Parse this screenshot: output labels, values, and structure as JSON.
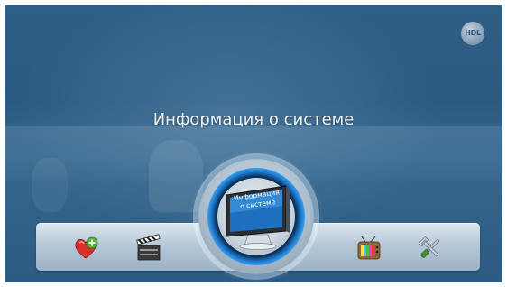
{
  "screen": {
    "title": "Информация о системе",
    "logo_text": "HDL"
  },
  "menu": {
    "items": [
      {
        "name": "favorites-icon",
        "label": ""
      },
      {
        "name": "media-clapper-icon",
        "label": ""
      },
      {
        "name": "system-info-monitor-icon",
        "label": "Информация о системе",
        "selected": true
      },
      {
        "name": "tv-icon",
        "label": ""
      },
      {
        "name": "settings-tools-icon",
        "label": ""
      }
    ],
    "selected_line1": "Информация",
    "selected_line2": "о системе"
  },
  "colors": {
    "background": "#2f5f86",
    "accent_ring": "#2a8fe6",
    "bar": "#b8c9d8",
    "title_text": "#eef3f8"
  }
}
